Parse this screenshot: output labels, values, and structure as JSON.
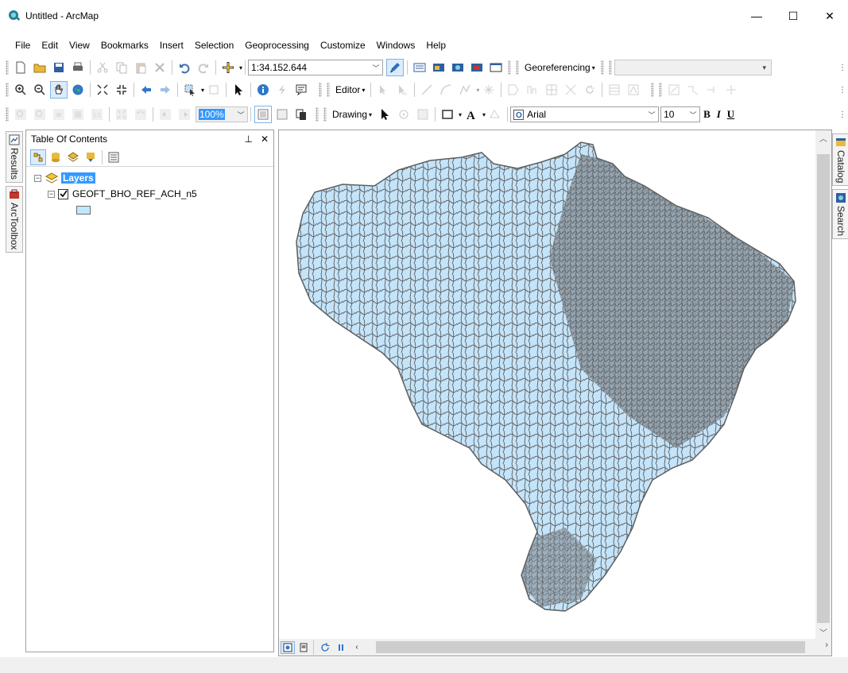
{
  "window": {
    "title": "Untitled - ArcMap",
    "minimize": "—",
    "maximize": "☐",
    "close": "✕"
  },
  "menu": [
    "File",
    "Edit",
    "View",
    "Bookmarks",
    "Insert",
    "Selection",
    "Geoprocessing",
    "Customize",
    "Windows",
    "Help"
  ],
  "toolbar": {
    "scale": "1:34.152.644",
    "georeferencing_label": "Georeferencing",
    "editor_label": "Editor",
    "drawing_label": "Drawing",
    "zoom_percent": "100%",
    "font_name": "Arial",
    "font_size": "10",
    "bold": "B",
    "italic": "I",
    "underline": "U"
  },
  "left_tabs": [
    "Results",
    "ArcToolbox"
  ],
  "right_tabs": [
    "Catalog",
    "Search"
  ],
  "toc": {
    "title": "Table Of Contents",
    "pin": "⊥",
    "close": "✕",
    "layers_label": "Layers",
    "layer_name": "GEOFT_BHO_REF_ACH_n5",
    "layer_checked": true,
    "fill_color": "#bee8ff",
    "outline_color": "#6e6e6e"
  },
  "map": {
    "fill_color": "#c4e4fa",
    "line_color": "#5e5e5e"
  },
  "colors": {
    "selection": "#3399ff",
    "scroll_thumb": "#cdcdcd"
  }
}
